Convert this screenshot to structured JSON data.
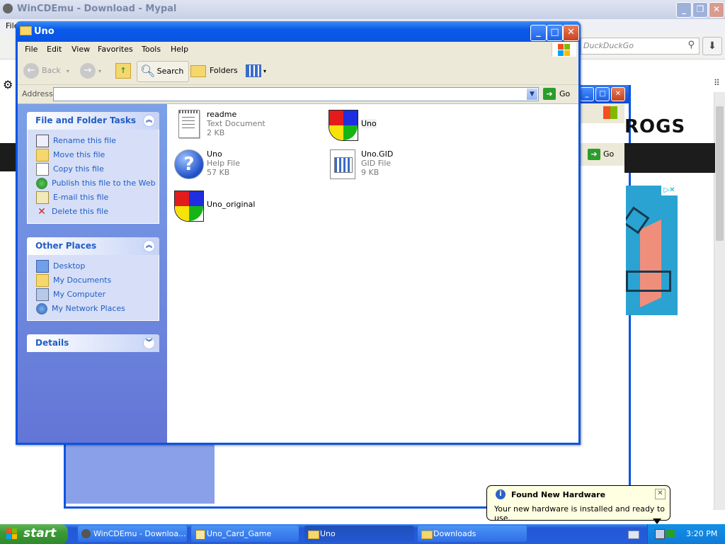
{
  "browser": {
    "title": "WinCDEmu - Download - Mypal",
    "menu_file": "File",
    "search_placeholder": "DuckDuckGo",
    "page_logo_text": "ROGS",
    "go_label": "Go"
  },
  "window": {
    "title": "Uno",
    "menu": [
      "File",
      "Edit",
      "View",
      "Favorites",
      "Tools",
      "Help"
    ],
    "toolbar": {
      "back": "Back",
      "search": "Search",
      "folders": "Folders"
    },
    "address_label": "Address",
    "address_value": "",
    "go_label": "Go"
  },
  "taskpane": {
    "file_tasks": {
      "title": "File and Folder Tasks",
      "items": [
        "Rename this file",
        "Move this file",
        "Copy this file",
        "Publish this file to the Web",
        "E-mail this file",
        "Delete this file"
      ]
    },
    "other_places": {
      "title": "Other Places",
      "items": [
        "Desktop",
        "My Documents",
        "My Computer",
        "My Network Places"
      ]
    },
    "details": {
      "title": "Details"
    }
  },
  "files": [
    {
      "name": "readme",
      "type": "Text Document",
      "size": "2 KB",
      "icon": "text-document-icon"
    },
    {
      "name": "Uno",
      "type": "",
      "size": "",
      "icon": "uno-app-icon"
    },
    {
      "name": "Uno",
      "type": "Help File",
      "size": "57 KB",
      "icon": "help-file-icon"
    },
    {
      "name": "Uno.GID",
      "type": "GID File",
      "size": "9 KB",
      "icon": "gid-file-icon"
    },
    {
      "name": "Uno_original",
      "type": "",
      "size": "",
      "icon": "uno-app-icon"
    }
  ],
  "taskbar": {
    "start": "start",
    "tasks": [
      "WinCDEmu - Downloa...",
      "Uno_Card_Game",
      "Uno",
      "Downloads"
    ],
    "clock": "3:20 PM"
  },
  "balloon": {
    "title": "Found New Hardware",
    "message": "Your new hardware is installed and ready to use."
  },
  "colors": {
    "xp_blue": "#0a54e3",
    "taskpane": "#7ba1e8",
    "link": "#215dc6",
    "start_green": "#3c9a35"
  }
}
